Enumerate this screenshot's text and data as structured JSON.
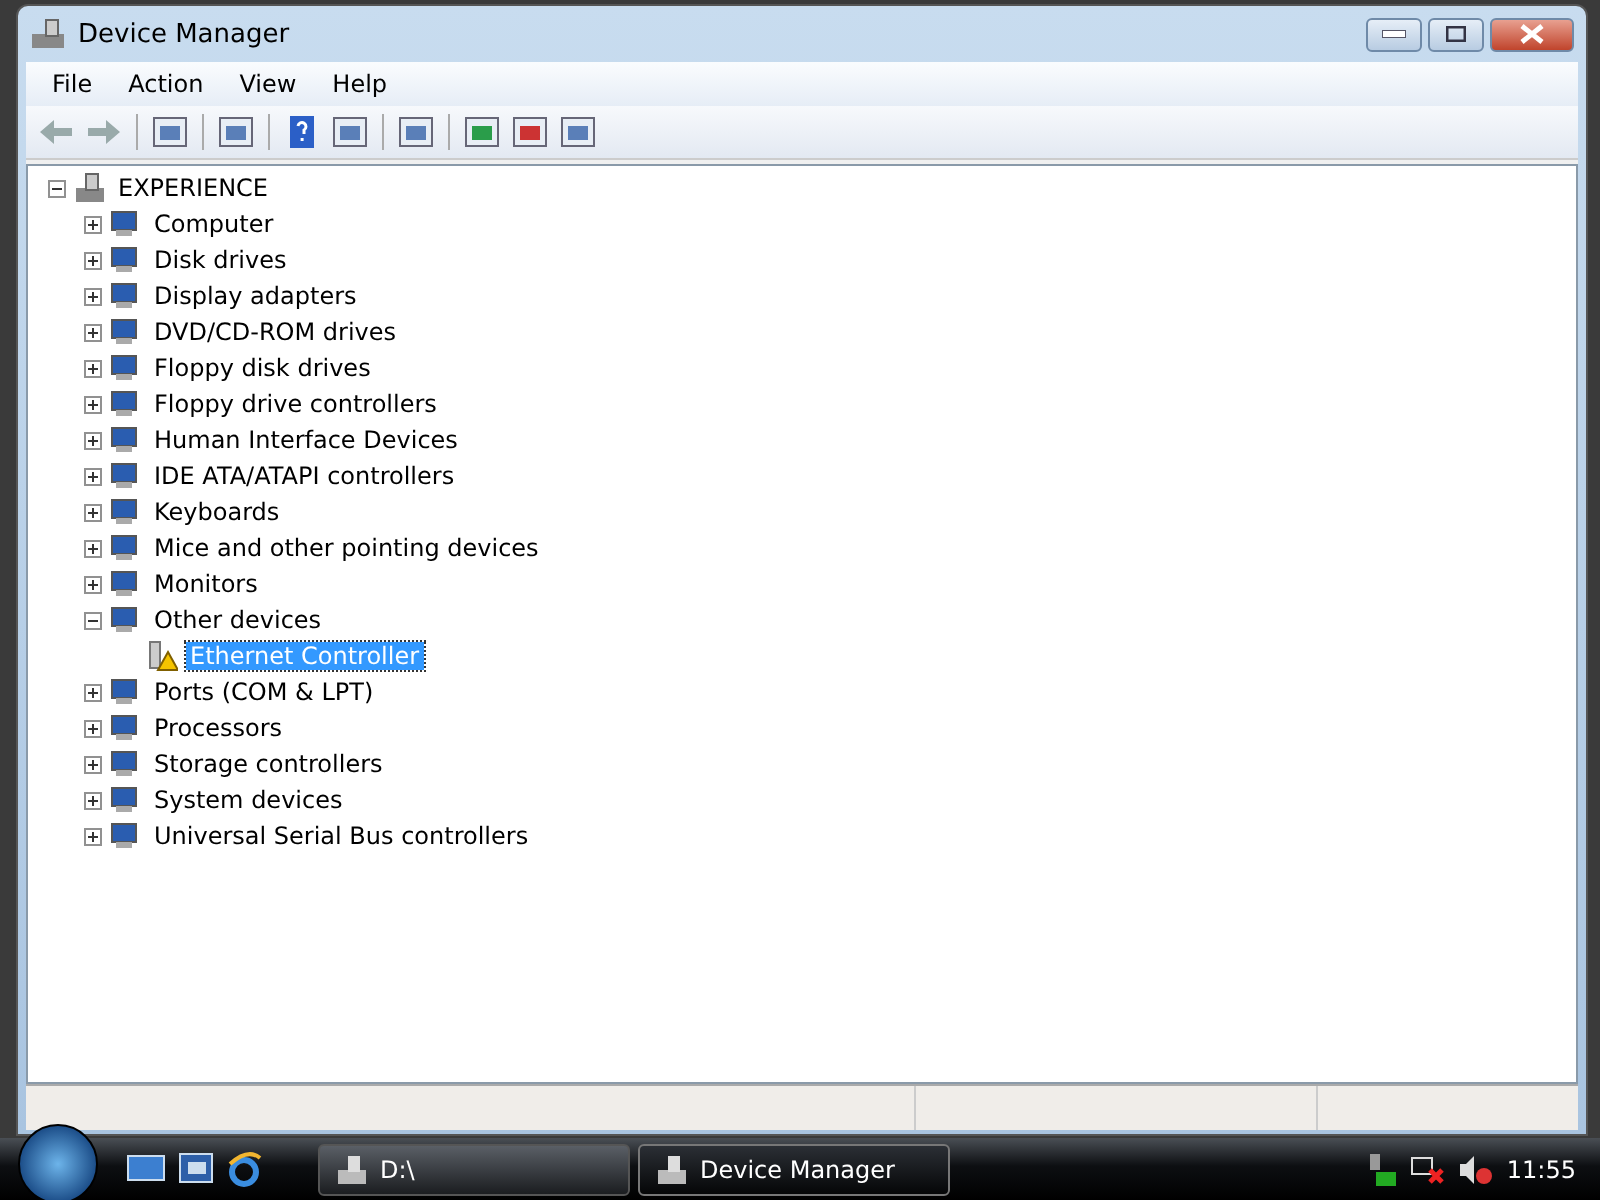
{
  "window": {
    "title": "Device Manager"
  },
  "menu": [
    "File",
    "Action",
    "View",
    "Help"
  ],
  "tree": {
    "label": "EXPERIENCE",
    "expanded": true,
    "children": [
      {
        "label": "Computer",
        "expanded": false,
        "selected": false
      },
      {
        "label": "Disk drives",
        "expanded": false,
        "selected": false
      },
      {
        "label": "Display adapters",
        "expanded": false,
        "selected": false
      },
      {
        "label": "DVD/CD-ROM drives",
        "expanded": false,
        "selected": false
      },
      {
        "label": "Floppy disk drives",
        "expanded": false,
        "selected": false
      },
      {
        "label": "Floppy drive controllers",
        "expanded": false,
        "selected": false
      },
      {
        "label": "Human Interface Devices",
        "expanded": false,
        "selected": false
      },
      {
        "label": "IDE ATA/ATAPI controllers",
        "expanded": false,
        "selected": false
      },
      {
        "label": "Keyboards",
        "expanded": false,
        "selected": false
      },
      {
        "label": "Mice and other pointing devices",
        "expanded": false,
        "selected": false
      },
      {
        "label": "Monitors",
        "expanded": false,
        "selected": false
      },
      {
        "label": "Other devices",
        "expanded": true,
        "selected": false,
        "children": [
          {
            "label": "Ethernet Controller",
            "selected": true,
            "warning": true
          }
        ]
      },
      {
        "label": "Ports (COM & LPT)",
        "expanded": false,
        "selected": false
      },
      {
        "label": "Processors",
        "expanded": false,
        "selected": false
      },
      {
        "label": "Storage controllers",
        "expanded": false,
        "selected": false
      },
      {
        "label": "System devices",
        "expanded": false,
        "selected": false
      },
      {
        "label": "Universal Serial Bus controllers",
        "expanded": false,
        "selected": false
      }
    ]
  },
  "taskbar": {
    "tasks": [
      {
        "label": "D:\\",
        "selected": false
      },
      {
        "label": "Device Manager",
        "selected": true
      }
    ],
    "clock": "11:55"
  }
}
